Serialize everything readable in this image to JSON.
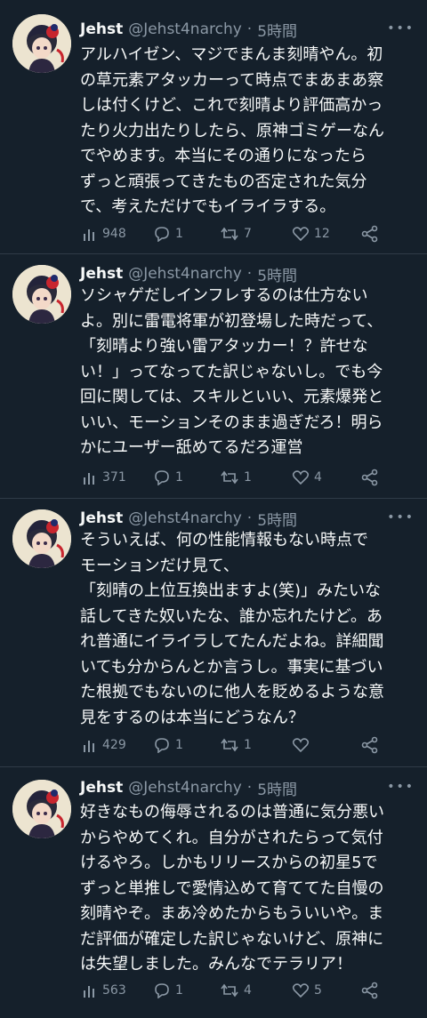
{
  "tweets": [
    {
      "name": "Jehst",
      "handle": "@Jehst4narchy",
      "sep": "·",
      "time": "5時間",
      "lines": [
        "アルハイゼン、マジでまんま刻晴やん。初",
        "の草元素アタッカーって時点でまあまあ察",
        "しは付くけど、これで刻晴より評価高かっ",
        "たり火力出たりしたら、原神ゴミゲーなん",
        "でやめます。本当にその通りになったら",
        "ずっと頑張ってきたもの否定された気分",
        "で、考えただけでもイライラする。"
      ],
      "views": "948",
      "replies": "1",
      "retweets": "7",
      "likes": "12"
    },
    {
      "name": "Jehst",
      "handle": "@Jehst4narchy",
      "sep": "·",
      "time": "5時間",
      "lines": [
        "ソシャゲだしインフレするのは仕方ない",
        "よ。別に雷電将軍が初登場した時だって、",
        "「刻晴より強い雷アタッカー！？許せな",
        "い！」ってなってた訳じゃないし。でも今",
        "回に関しては、スキルといい、元素爆発と",
        "いい、モーションそのまま過ぎだろ！明ら",
        "かにユーザー舐めてるだろ運営"
      ],
      "views": "371",
      "replies": "1",
      "retweets": "1",
      "likes": "4"
    },
    {
      "name": "Jehst",
      "handle": "@Jehst4narchy",
      "sep": "·",
      "time": "5時間",
      "lines": [
        "そういえば、何の性能情報もない時点で",
        "モーションだけ見て、",
        "「刻晴の上位互換出ますよ(笑)」みたいな",
        "話してきた奴いたな、誰か忘れたけど。あ",
        "れ普通にイライラしてたんだよね。詳細聞",
        "いても分からんとか言うし。事実に基づい",
        "た根拠でもないのに他人を貶めるような意",
        "見をするのは本当にどうなん？"
      ],
      "views": "429",
      "replies": "1",
      "retweets": "1",
      "likes": ""
    },
    {
      "name": "Jehst",
      "handle": "@Jehst4narchy",
      "sep": "·",
      "time": "5時間",
      "lines": [
        "好きなもの侮辱されるのは普通に気分悪い",
        "からやめてくれ。自分がされたらって気付",
        "けるやろ。しかもリリースからの初星5で",
        "ずっと単推しで愛情込めて育ててた自慢の",
        "刻晴やぞ。まあ冷めたからもういいや。ま",
        "だ評価が確定した訳じゃないけど、原神に",
        "は失望しました。みんなでテラリア！"
      ],
      "views": "563",
      "replies": "1",
      "retweets": "4",
      "likes": "5"
    }
  ]
}
